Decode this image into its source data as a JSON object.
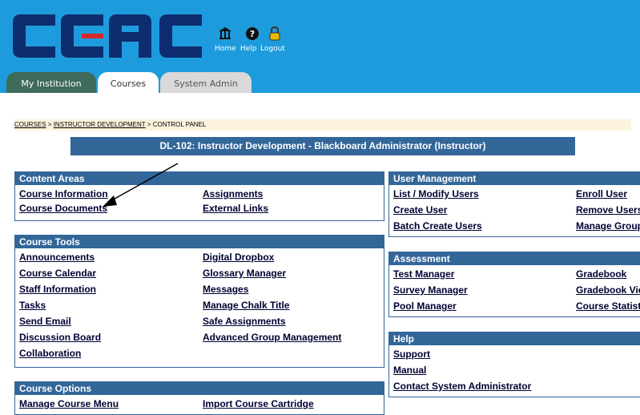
{
  "brand": {
    "logo_text": "CCAC",
    "logo_color": "#0d2d70",
    "accent_red": "#d62828",
    "header_color": "#1e9bdc"
  },
  "top_links": [
    {
      "icon": "home-icon",
      "label": "Home"
    },
    {
      "icon": "help-icon",
      "label": "Help"
    },
    {
      "icon": "logout-icon",
      "label": "Logout"
    }
  ],
  "tabs": [
    {
      "label": "My Institution"
    },
    {
      "label": "Courses",
      "active": true
    },
    {
      "label": "System Admin"
    }
  ],
  "breadcrumb": [
    "COURSES",
    "INSTRUCTOR DEVELOPMENT",
    "CONTROL PANEL"
  ],
  "breadcrumb_sep": ">",
  "course_title": "DL-102: Instructor Development - Blackboard Administrator (Instructor)",
  "panels": {
    "content_areas": {
      "title": "Content Areas",
      "links": [
        "Course Information",
        "Assignments",
        "Course Documents",
        "External Links"
      ]
    },
    "course_tools": {
      "title": "Course Tools",
      "links": [
        "Announcements",
        "Digital Dropbox",
        "Course Calendar",
        "Glossary Manager",
        "Staff Information",
        "Messages",
        "Tasks",
        "Manage Chalk Title",
        "Send Email",
        "Safe Assignments",
        "Discussion Board",
        "Advanced Group Management",
        "Collaboration"
      ]
    },
    "course_options": {
      "title": "Course Options",
      "links": [
        "Manage Course Menu",
        "Import Course Cartridge"
      ]
    },
    "user_management": {
      "title": "User Management",
      "links": [
        "List / Modify Users",
        "Enroll User",
        "Create User",
        "Remove Users",
        "Batch Create Users",
        "Manage Groups"
      ]
    },
    "assessment": {
      "title": "Assessment",
      "links": [
        "Test Manager",
        "Gradebook",
        "Survey Manager",
        "Gradebook Views",
        "Pool Manager",
        "Course Statistics"
      ]
    },
    "help": {
      "title": "Help",
      "links": [
        "Support",
        "Manual",
        "Contact System Administrator"
      ]
    }
  }
}
